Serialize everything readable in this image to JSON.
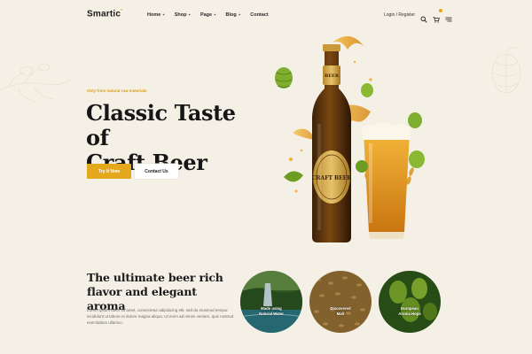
{
  "header": {
    "logo": "Smartic",
    "nav": [
      {
        "label": "Home"
      },
      {
        "label": "Shop"
      },
      {
        "label": "Page"
      },
      {
        "label": "Blog"
      },
      {
        "label": "Contact"
      }
    ],
    "login_label": "Login / Register",
    "icons": [
      "search-icon",
      "cart-icon",
      "menu-icon"
    ]
  },
  "hero": {
    "eyebrow": "Only from natural raw materials",
    "title_line1": "Classic Taste of",
    "title_line2": "Craft Beer",
    "primary_button": "Try It Now",
    "secondary_button": "Contact Us",
    "bottle_label_top": "BEER",
    "bottle_label_main": "CRAFT BEER"
  },
  "section": {
    "title_line1": "The ultimate beer rich",
    "title_line2": "flavor and elegant aroma",
    "body": "Lorem ipsum dolor sit amet, consectetur adipisicing elit, sed do eiusmod tempor incididunt ut labore et dolore magna aliqua. Ut enim ad minim veniam, quis nostrud exercitation ullamco."
  },
  "features": [
    {
      "line1": "Made using",
      "line2": "Natural Water"
    },
    {
      "line1": "Discovered",
      "line2": "Malt"
    },
    {
      "line1": "European",
      "line2": "Aroma Hops"
    }
  ],
  "colors": {
    "accent": "#e4a81d",
    "background": "#f5f0e6",
    "text": "#161616"
  }
}
